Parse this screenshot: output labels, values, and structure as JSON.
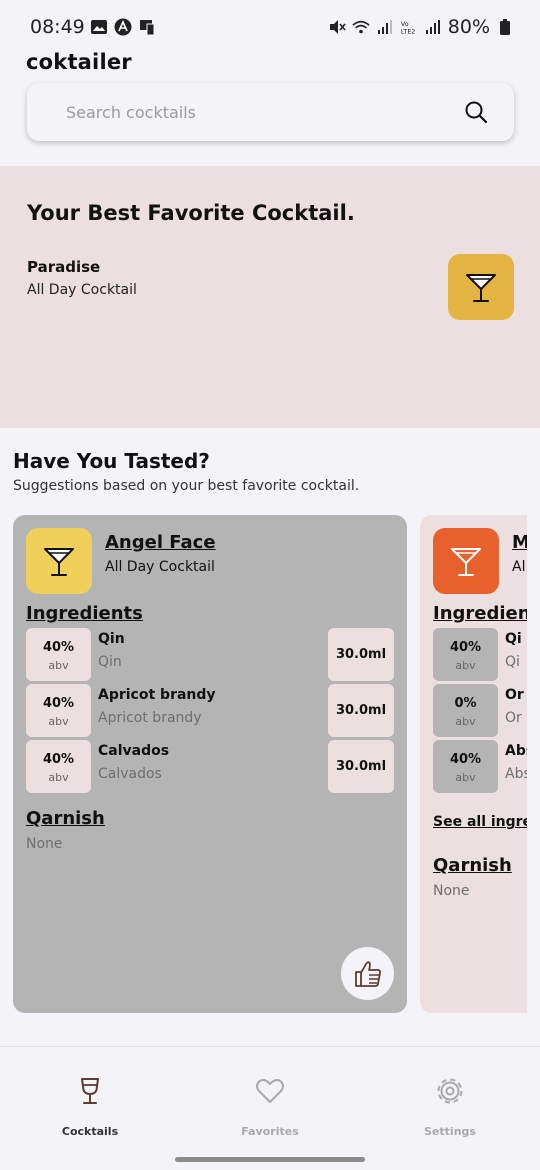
{
  "status_bar": {
    "time": "08:49",
    "battery": "80%",
    "icons_left": [
      "gallery-icon",
      "app-icon",
      "cast-icon"
    ],
    "icons_right": [
      "mute-icon",
      "wifi-icon",
      "signal-icon",
      "volte-icon",
      "signal-icon",
      "battery-icon"
    ]
  },
  "app": {
    "title": "coktailer"
  },
  "search": {
    "placeholder": "Search cocktails"
  },
  "favorite": {
    "heading": "Your Best Favorite Cocktail.",
    "name": "Paradise",
    "category": "All Day Cocktail",
    "icon": "cocktail-glass-icon",
    "icon_color": "#e4b443"
  },
  "suggestions": {
    "heading": "Have You Tasted?",
    "subheading": "Suggestions based on your best favorite cocktail.",
    "cards": [
      {
        "name": "Angel Face",
        "category": "All Day Cocktail",
        "icon_color": "#f0cf5a",
        "background": "#b4b4b4",
        "ingredients_heading": "Ingredients",
        "ingredients": [
          {
            "abv": "40%",
            "abv_label": "abv",
            "name": "Qin",
            "alt": "Qin",
            "volume": "30.0ml"
          },
          {
            "abv": "40%",
            "abv_label": "abv",
            "name": "Apricot brandy",
            "alt": "Apricot brandy",
            "volume": "30.0ml"
          },
          {
            "abv": "40%",
            "abv_label": "abv",
            "name": "Calvados",
            "alt": "Calvados",
            "volume": "30.0ml"
          }
        ],
        "garnish_heading": "Qarnish",
        "garnish": "None"
      },
      {
        "name": "M",
        "category": "Al",
        "icon_color": "#e8612c",
        "background": "#ecdfe0",
        "ingredients_heading": "Ingredients",
        "ingredients": [
          {
            "abv": "40%",
            "abv_label": "abv",
            "name": "Qi",
            "alt": "Qi"
          },
          {
            "abv": "0%",
            "abv_label": "abv",
            "name": "Or",
            "alt": "Or"
          },
          {
            "abv": "40%",
            "abv_label": "abv",
            "name": "Abs",
            "alt": "Abs"
          }
        ],
        "see_all": "See all ingredients",
        "garnish_heading": "Qarnish",
        "garnish": "None"
      }
    ]
  },
  "bottom_nav": {
    "items": [
      {
        "label": "Cocktails",
        "icon": "cocktail-glass-icon",
        "active": true
      },
      {
        "label": "Favorites",
        "icon": "heart-icon",
        "active": false
      },
      {
        "label": "Settings",
        "icon": "gear-icon",
        "active": false
      }
    ],
    "active_color": "#5a3d33",
    "inactive_color": "#a9a9ad"
  }
}
